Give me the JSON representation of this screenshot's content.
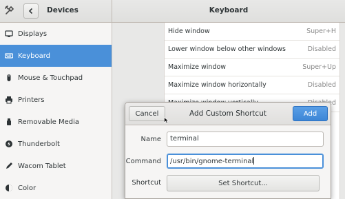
{
  "header": {
    "left_title": "Devices",
    "right_title": "Keyboard"
  },
  "sidebar": {
    "items": [
      {
        "label": "Displays",
        "icon": "display-icon",
        "selected": false
      },
      {
        "label": "Keyboard",
        "icon": "keyboard-icon",
        "selected": true
      },
      {
        "label": "Mouse & Touchpad",
        "icon": "mouse-icon",
        "selected": false
      },
      {
        "label": "Printers",
        "icon": "printer-icon",
        "selected": false
      },
      {
        "label": "Removable Media",
        "icon": "media-icon",
        "selected": false
      },
      {
        "label": "Thunderbolt",
        "icon": "thunderbolt-icon",
        "selected": false
      },
      {
        "label": "Wacom Tablet",
        "icon": "tablet-icon",
        "selected": false
      },
      {
        "label": "Color",
        "icon": "color-icon",
        "selected": false
      }
    ]
  },
  "shortcuts": [
    {
      "name": "Hide window",
      "accel": "Super+H"
    },
    {
      "name": "Lower window below other windows",
      "accel": "Disabled"
    },
    {
      "name": "Maximize window",
      "accel": "Super+Up"
    },
    {
      "name": "Maximize window horizontally",
      "accel": "Disabled"
    },
    {
      "name": "Maximize window vertically",
      "accel": "Disabled"
    }
  ],
  "dialog": {
    "title": "Add Custom Shortcut",
    "cancel_label": "Cancel",
    "add_label": "Add",
    "name_label": "Name",
    "name_value": "terminal",
    "command_label": "Command",
    "command_value": "/usr/bin/gnome-terminal",
    "shortcut_label": "Shortcut",
    "shortcut_button": "Set Shortcut..."
  },
  "colors": {
    "accent": "#4a90d9",
    "sidebar_bg": "#f6f5f4",
    "header_bg": "#e8e8e7"
  }
}
